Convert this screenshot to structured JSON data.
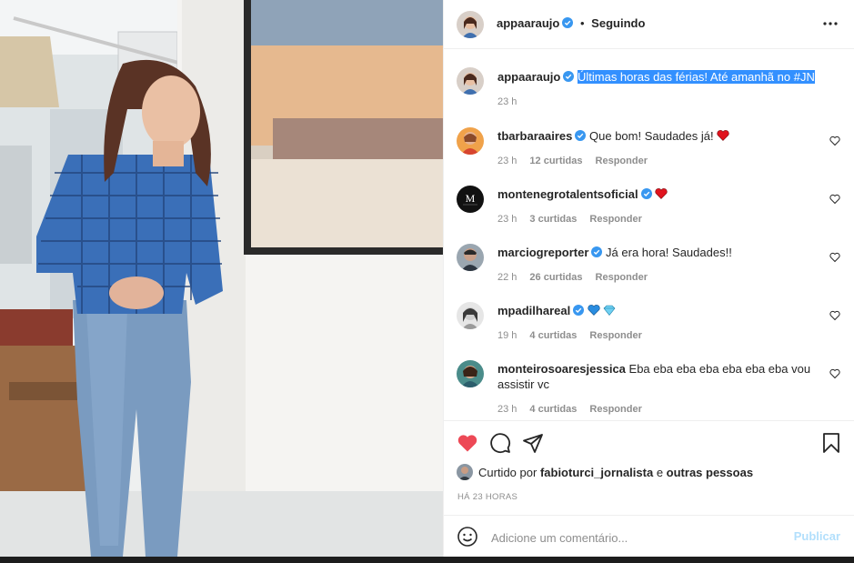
{
  "header": {
    "username": "appaaraujo",
    "separator": "•",
    "follow_state": "Seguindo"
  },
  "caption": {
    "username": "appaaraujo",
    "text": "Últimas horas das férias! Até amanhã no #JN",
    "time": "23 h"
  },
  "comments": [
    {
      "username": "tbarbaraaires",
      "verified": true,
      "text": "Que bom! Saudades já!",
      "emoji": "red-heart",
      "time": "23 h",
      "likes": "12 curtidas",
      "reply": "Responder"
    },
    {
      "username": "montenegrotalentsoficial",
      "verified": true,
      "text": "",
      "emoji": "red-heart",
      "time": "23 h",
      "likes": "3 curtidas",
      "reply": "Responder"
    },
    {
      "username": "marciogreporter",
      "verified": true,
      "text": "Já era hora! Saudades!!",
      "emoji": "",
      "time": "22 h",
      "likes": "26 curtidas",
      "reply": "Responder"
    },
    {
      "username": "mpadilhareal",
      "verified": true,
      "text": "",
      "emoji": "blue-heart-diamond",
      "time": "19 h",
      "likes": "4 curtidas",
      "reply": "Responder"
    },
    {
      "username": "monteiroso aresjessica",
      "verified": false,
      "text": "Eba eba eba eba eba eba eba vou assistir vc",
      "emoji": "",
      "time": "23 h",
      "likes": "4 curtidas",
      "reply": "Responder"
    }
  ],
  "likes": {
    "prefix": "Curtido por",
    "user": "fabioturci_jornalista",
    "connector": "e",
    "others": "outras pessoas"
  },
  "timestamp": "HÁ 23 HORAS",
  "add_comment": {
    "placeholder": "Adicione um comentário...",
    "publish_label": "Publicar"
  },
  "icons": {
    "more": "more-horizontal-icon",
    "like": "heart-filled-icon",
    "comment": "comment-icon",
    "share": "share-icon",
    "save": "bookmark-icon",
    "emoji": "emoji-icon"
  },
  "colors": {
    "verified": "#3897f0",
    "like_red": "#ed4956",
    "selection": "#3390ff",
    "muted": "#8e8e8e",
    "publish_disabled": "#b2dffc"
  }
}
